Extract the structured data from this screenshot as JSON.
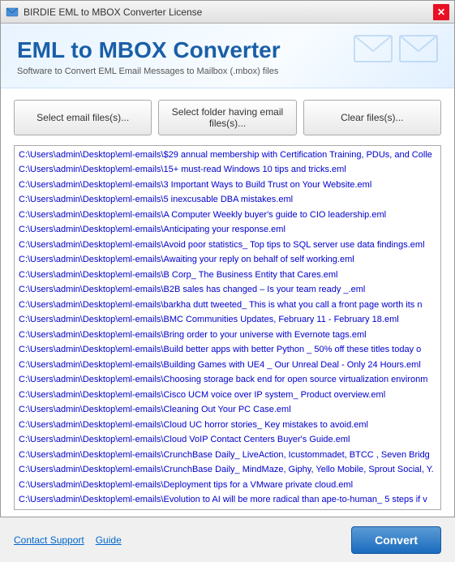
{
  "window": {
    "title": "BIRDIE EML to MBOX Converter License"
  },
  "header": {
    "app_title": "EML to MBOX Converter",
    "app_subtitle": "Software to Convert EML Email Messages to Mailbox (.mbox) files"
  },
  "buttons": {
    "select_files": "Select email files(s)...",
    "select_folder": "Select folder having email files(s)...",
    "clear_files": "Clear files(s)..."
  },
  "files": [
    "C:\\Users\\admin\\Desktop\\eml-emails\\$29 annual membership with Certification Training, PDUs, and Colle",
    "C:\\Users\\admin\\Desktop\\eml-emails\\15+ must-read Windows 10 tips and tricks.eml",
    "C:\\Users\\admin\\Desktop\\eml-emails\\3 Important Ways to Build Trust on Your Website.eml",
    "C:\\Users\\admin\\Desktop\\eml-emails\\5 inexcusable DBA mistakes.eml",
    "C:\\Users\\admin\\Desktop\\eml-emails\\A Computer Weekly buyer's guide to CIO leadership.eml",
    "C:\\Users\\admin\\Desktop\\eml-emails\\Anticipating your response.eml",
    "C:\\Users\\admin\\Desktop\\eml-emails\\Avoid poor statistics_ Top tips to SQL server use data findings.eml",
    "C:\\Users\\admin\\Desktop\\eml-emails\\Awaiting your reply on behalf of self working.eml",
    "C:\\Users\\admin\\Desktop\\eml-emails\\B Corp_ The Business Entity that Cares.eml",
    "C:\\Users\\admin\\Desktop\\eml-emails\\B2B sales has changed – Is your team ready _.eml",
    "C:\\Users\\admin\\Desktop\\eml-emails\\barkha dutt tweeted_ This is what you call a front page worth its n",
    "C:\\Users\\admin\\Desktop\\eml-emails\\BMC Communities Updates, February 11 - February 18.eml",
    "C:\\Users\\admin\\Desktop\\eml-emails\\Bring order to your universe with Evernote tags.eml",
    "C:\\Users\\admin\\Desktop\\eml-emails\\Build better apps with better Python _ 50% off these titles today o",
    "C:\\Users\\admin\\Desktop\\eml-emails\\Building Games with UE4 _ Our Unreal Deal - Only 24 Hours.eml",
    "C:\\Users\\admin\\Desktop\\eml-emails\\Choosing storage back end for open source virtualization environm",
    "C:\\Users\\admin\\Desktop\\eml-emails\\Cisco UCM voice over IP system_ Product overview.eml",
    "C:\\Users\\admin\\Desktop\\eml-emails\\Cleaning Out Your PC Case.eml",
    "C:\\Users\\admin\\Desktop\\eml-emails\\Cloud UC horror stories_ Key mistakes to avoid.eml",
    "C:\\Users\\admin\\Desktop\\eml-emails\\Cloud VoIP Contact Centers Buyer's Guide.eml",
    "C:\\Users\\admin\\Desktop\\eml-emails\\CrunchBase Daily_ LiveAction, Icustommadet, BTCC , Seven Bridg",
    "C:\\Users\\admin\\Desktop\\eml-emails\\CrunchBase Daily_ MindMaze, Giphy, Yello Mobile, Sprout Social, Y.",
    "C:\\Users\\admin\\Desktop\\eml-emails\\Deployment tips for a VMware private cloud.eml",
    "C:\\Users\\admin\\Desktop\\eml-emails\\Evolution to AI will be more radical than ape-to-human_ 5 steps if v"
  ],
  "footer": {
    "contact_support": "Contact Support",
    "guide": "Guide",
    "convert": "Convert"
  }
}
